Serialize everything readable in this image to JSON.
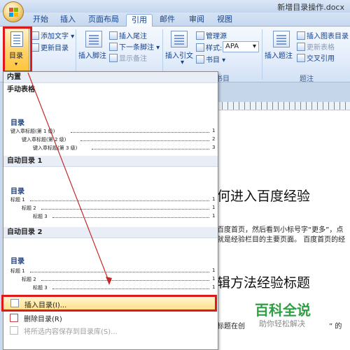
{
  "window": {
    "title": "新增目录操作.docx"
  },
  "tabs": [
    "开始",
    "插入",
    "页面布局",
    "引用",
    "邮件",
    "审阅",
    "视图"
  ],
  "ribbon": {
    "toc_button": "目录",
    "add_text": "添加文字",
    "update_toc": "更新目录",
    "insert_footnote": "插入脚注",
    "insert_endnote": "插入尾注",
    "next_footnote": "下一条脚注",
    "show_notes": "显示备注",
    "insert_citation": "插入引文",
    "manage_sources": "管理源",
    "style_label": "样式:",
    "style_value": "APA",
    "bibliography": "书目",
    "group_citations": "书目",
    "insert_caption": "插入题注",
    "insert_table_of_figures": "插入图表目录",
    "update_table": "更新表格",
    "cross_reference": "交叉引用",
    "group_captions": "题注"
  },
  "dropdown": {
    "builtin_header": "内置",
    "manual_table": "手动表格",
    "auto_toc_1": "自动目录 1",
    "auto_toc_2": "自动目录 2",
    "toc_title": "目录",
    "manual_lines": [
      "键入章标题(第 1 级)",
      "键入章标题(第 2 级)",
      "键入章标题(第 3 级)"
    ],
    "manual_nums": [
      "1",
      "2",
      "3"
    ],
    "auto_lines": [
      "标题 1",
      "标题 2",
      "标题 3"
    ],
    "auto_nums": [
      "1",
      "1",
      "1"
    ],
    "insert_toc": "插入目录(I)...",
    "remove_toc": "删除目录(R)",
    "save_selection": "将所选内容保存到目录库(S)..."
  },
  "document": {
    "heading1": "何进入百度经验",
    "para1": "百度首页，然后看到小标号字“更多”，点",
    "para2": "就是经验栏目的主要页面。 百度首页的经",
    "heading2": "辑方法经验标题",
    "para3": "标题在创",
    "para4": "” 的"
  },
  "watermark": {
    "brand": "百科全说",
    "slogan": "助你轻松解决"
  }
}
